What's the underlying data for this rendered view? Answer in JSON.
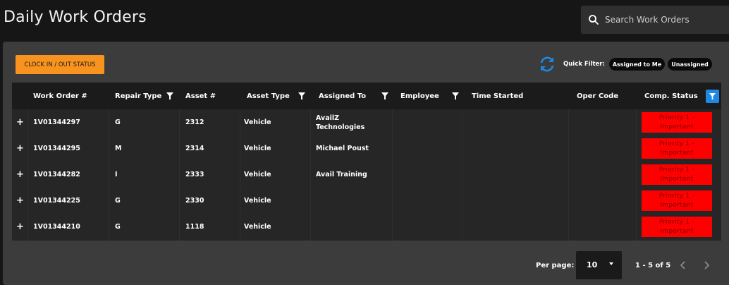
{
  "header": {
    "title": "Daily Work Orders",
    "search_placeholder": "Search Work Orders"
  },
  "toolbar": {
    "clock_button": "CLOCK IN / OUT STATUS",
    "quick_filter_label": "Quick Filter:",
    "quick_filters": [
      "Assigned to Me",
      "Unassigned"
    ]
  },
  "table": {
    "columns": [
      "Work Order #",
      "Repair Type",
      "Asset #",
      "Asset Type",
      "Assigned To",
      "Employee",
      "Time Started",
      "Oper Code",
      "Comp. Status"
    ],
    "rows": [
      {
        "expand": "+",
        "work_order": "1V01344297",
        "repair_type": "G",
        "asset": "2312",
        "asset_type": "Vehicle",
        "assigned_to": "AvailZ Technologies",
        "employee": "",
        "time_started": "",
        "oper_code": "",
        "status": "Priority 1 - Important"
      },
      {
        "expand": "+",
        "work_order": "1V01344295",
        "repair_type": "M",
        "asset": "2314",
        "asset_type": "Vehicle",
        "assigned_to": "Michael Poust",
        "employee": "",
        "time_started": "",
        "oper_code": "",
        "status": "Priority 1 - Important"
      },
      {
        "expand": "+",
        "work_order": "1V01344282",
        "repair_type": "I",
        "asset": "2333",
        "asset_type": "Vehicle",
        "assigned_to": "Avail Training",
        "employee": "",
        "time_started": "",
        "oper_code": "",
        "status": "Priority 1 - Important"
      },
      {
        "expand": "+",
        "work_order": "1V01344225",
        "repair_type": "G",
        "asset": "2330",
        "asset_type": "Vehicle",
        "assigned_to": "",
        "employee": "",
        "time_started": "",
        "oper_code": "",
        "status": "Priority 1 - Important"
      },
      {
        "expand": "+",
        "work_order": "1V01344210",
        "repair_type": "G",
        "asset": "1118",
        "asset_type": "Vehicle",
        "assigned_to": "",
        "employee": "",
        "time_started": "",
        "oper_code": "",
        "status": "Priority 1 - Important"
      }
    ]
  },
  "pagination": {
    "per_page_label": "Per page:",
    "per_page_value": "10",
    "range": "1 - 5 of 5"
  },
  "colors": {
    "accent": "#f7931e",
    "status_red": "#ff0000",
    "refresh_blue": "#1e88e5"
  },
  "icons": [
    "search-icon",
    "refresh-icon",
    "filter-icon",
    "expand-icon",
    "chevron-left-icon",
    "chevron-right-icon",
    "chevron-down-icon"
  ]
}
